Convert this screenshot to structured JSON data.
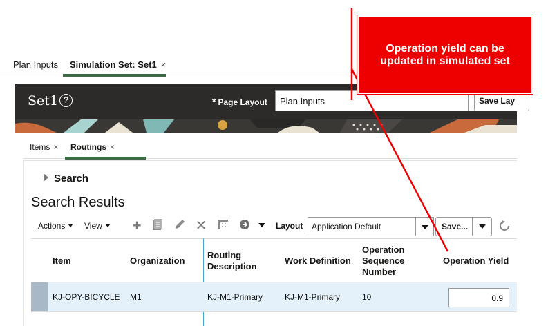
{
  "top_tabs": [
    {
      "label": "Plan Inputs"
    },
    {
      "label": "Simulation Set: Set1",
      "close": "×"
    }
  ],
  "header": {
    "title": "Set1",
    "help_icon": "?",
    "page_layout_required": "*",
    "page_layout_label": "Page Layout",
    "page_layout_value": "Plan Inputs",
    "save_layout_label": "Save Lay"
  },
  "sub_tabs": [
    {
      "label": "Items",
      "close": "×"
    },
    {
      "label": "Routings",
      "close": "×"
    }
  ],
  "search": {
    "label": "Search"
  },
  "results": {
    "title": "Search Results"
  },
  "toolbar": {
    "actions_label": "Actions",
    "view_label": "View",
    "icons": [
      "add-icon",
      "duplicate-icon",
      "edit-icon",
      "delete-icon",
      "freeze-icon",
      "go-icon",
      "more-dropdown-icon"
    ],
    "layout_label": "Layout",
    "layout_value": "Application Default",
    "save_label": "Save...",
    "reset_icon": "reset-icon"
  },
  "table": {
    "columns": {
      "item": "Item",
      "organization": "Organization",
      "routing_desc_1": "Routing",
      "routing_desc_2": "Description",
      "work_definition": "Work Definition",
      "op_seq_1": "Operation",
      "op_seq_2": "Sequence",
      "op_seq_3": "Number",
      "operation_yield": "Operation Yield"
    },
    "rows": [
      {
        "item": "KJ-OPY-BICYCLE",
        "organization": "M1",
        "routing_description": "KJ-M1-Primary",
        "work_definition": "KJ-M1-Primary",
        "operation_sequence": "10",
        "operation_yield": "0.9"
      }
    ]
  },
  "callout": {
    "line1": "Operation yield can be",
    "line2": "updated in simulated set",
    "color": "#ee0000"
  }
}
